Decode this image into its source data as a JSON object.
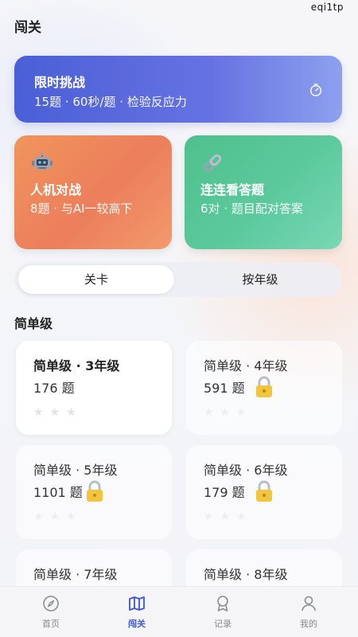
{
  "watermark": "eqi1tp",
  "header": {
    "title": "闯关"
  },
  "timed_challenge": {
    "title": "限时挑战",
    "subtitle": "15题 · 60秒/题 · 检验反应力",
    "icon": "stopwatch-icon"
  },
  "robot_battle": {
    "icon": "robot-icon",
    "title": "人机对战",
    "subtitle": "8题 · 与AI一较高下"
  },
  "match_answers": {
    "icon": "link-icon",
    "title": "连连看答题",
    "subtitle": "6对 · 题目配对答案"
  },
  "segment": {
    "tab_levels": "关卡",
    "tab_grade": "按年级"
  },
  "section": {
    "title": "简单级"
  },
  "levels": [
    {
      "name": "简单级 · 3年级",
      "count": "176 题",
      "locked": false,
      "stars": "★★★"
    },
    {
      "name": "简单级 · 4年级",
      "count": "591 题",
      "locked": true,
      "stars": "★★★"
    },
    {
      "name": "简单级 · 5年级",
      "count": "1101 题",
      "locked": true,
      "stars": "★★★"
    },
    {
      "name": "简单级 · 6年级",
      "count": "179 题",
      "locked": true,
      "stars": "★★★"
    },
    {
      "name": "简单级 · 7年级",
      "count": "",
      "locked": true,
      "stars": ""
    },
    {
      "name": "简单级 · 8年级",
      "count": "",
      "locked": true,
      "stars": ""
    }
  ],
  "tabbar": {
    "home": "首页",
    "levels": "闯关",
    "records": "记录",
    "mine": "我的"
  },
  "colors": {
    "accent": "#3d53d8",
    "timed_card": "#5566dc",
    "robot_card": "#ee8a5e",
    "link_card": "#58c597"
  }
}
